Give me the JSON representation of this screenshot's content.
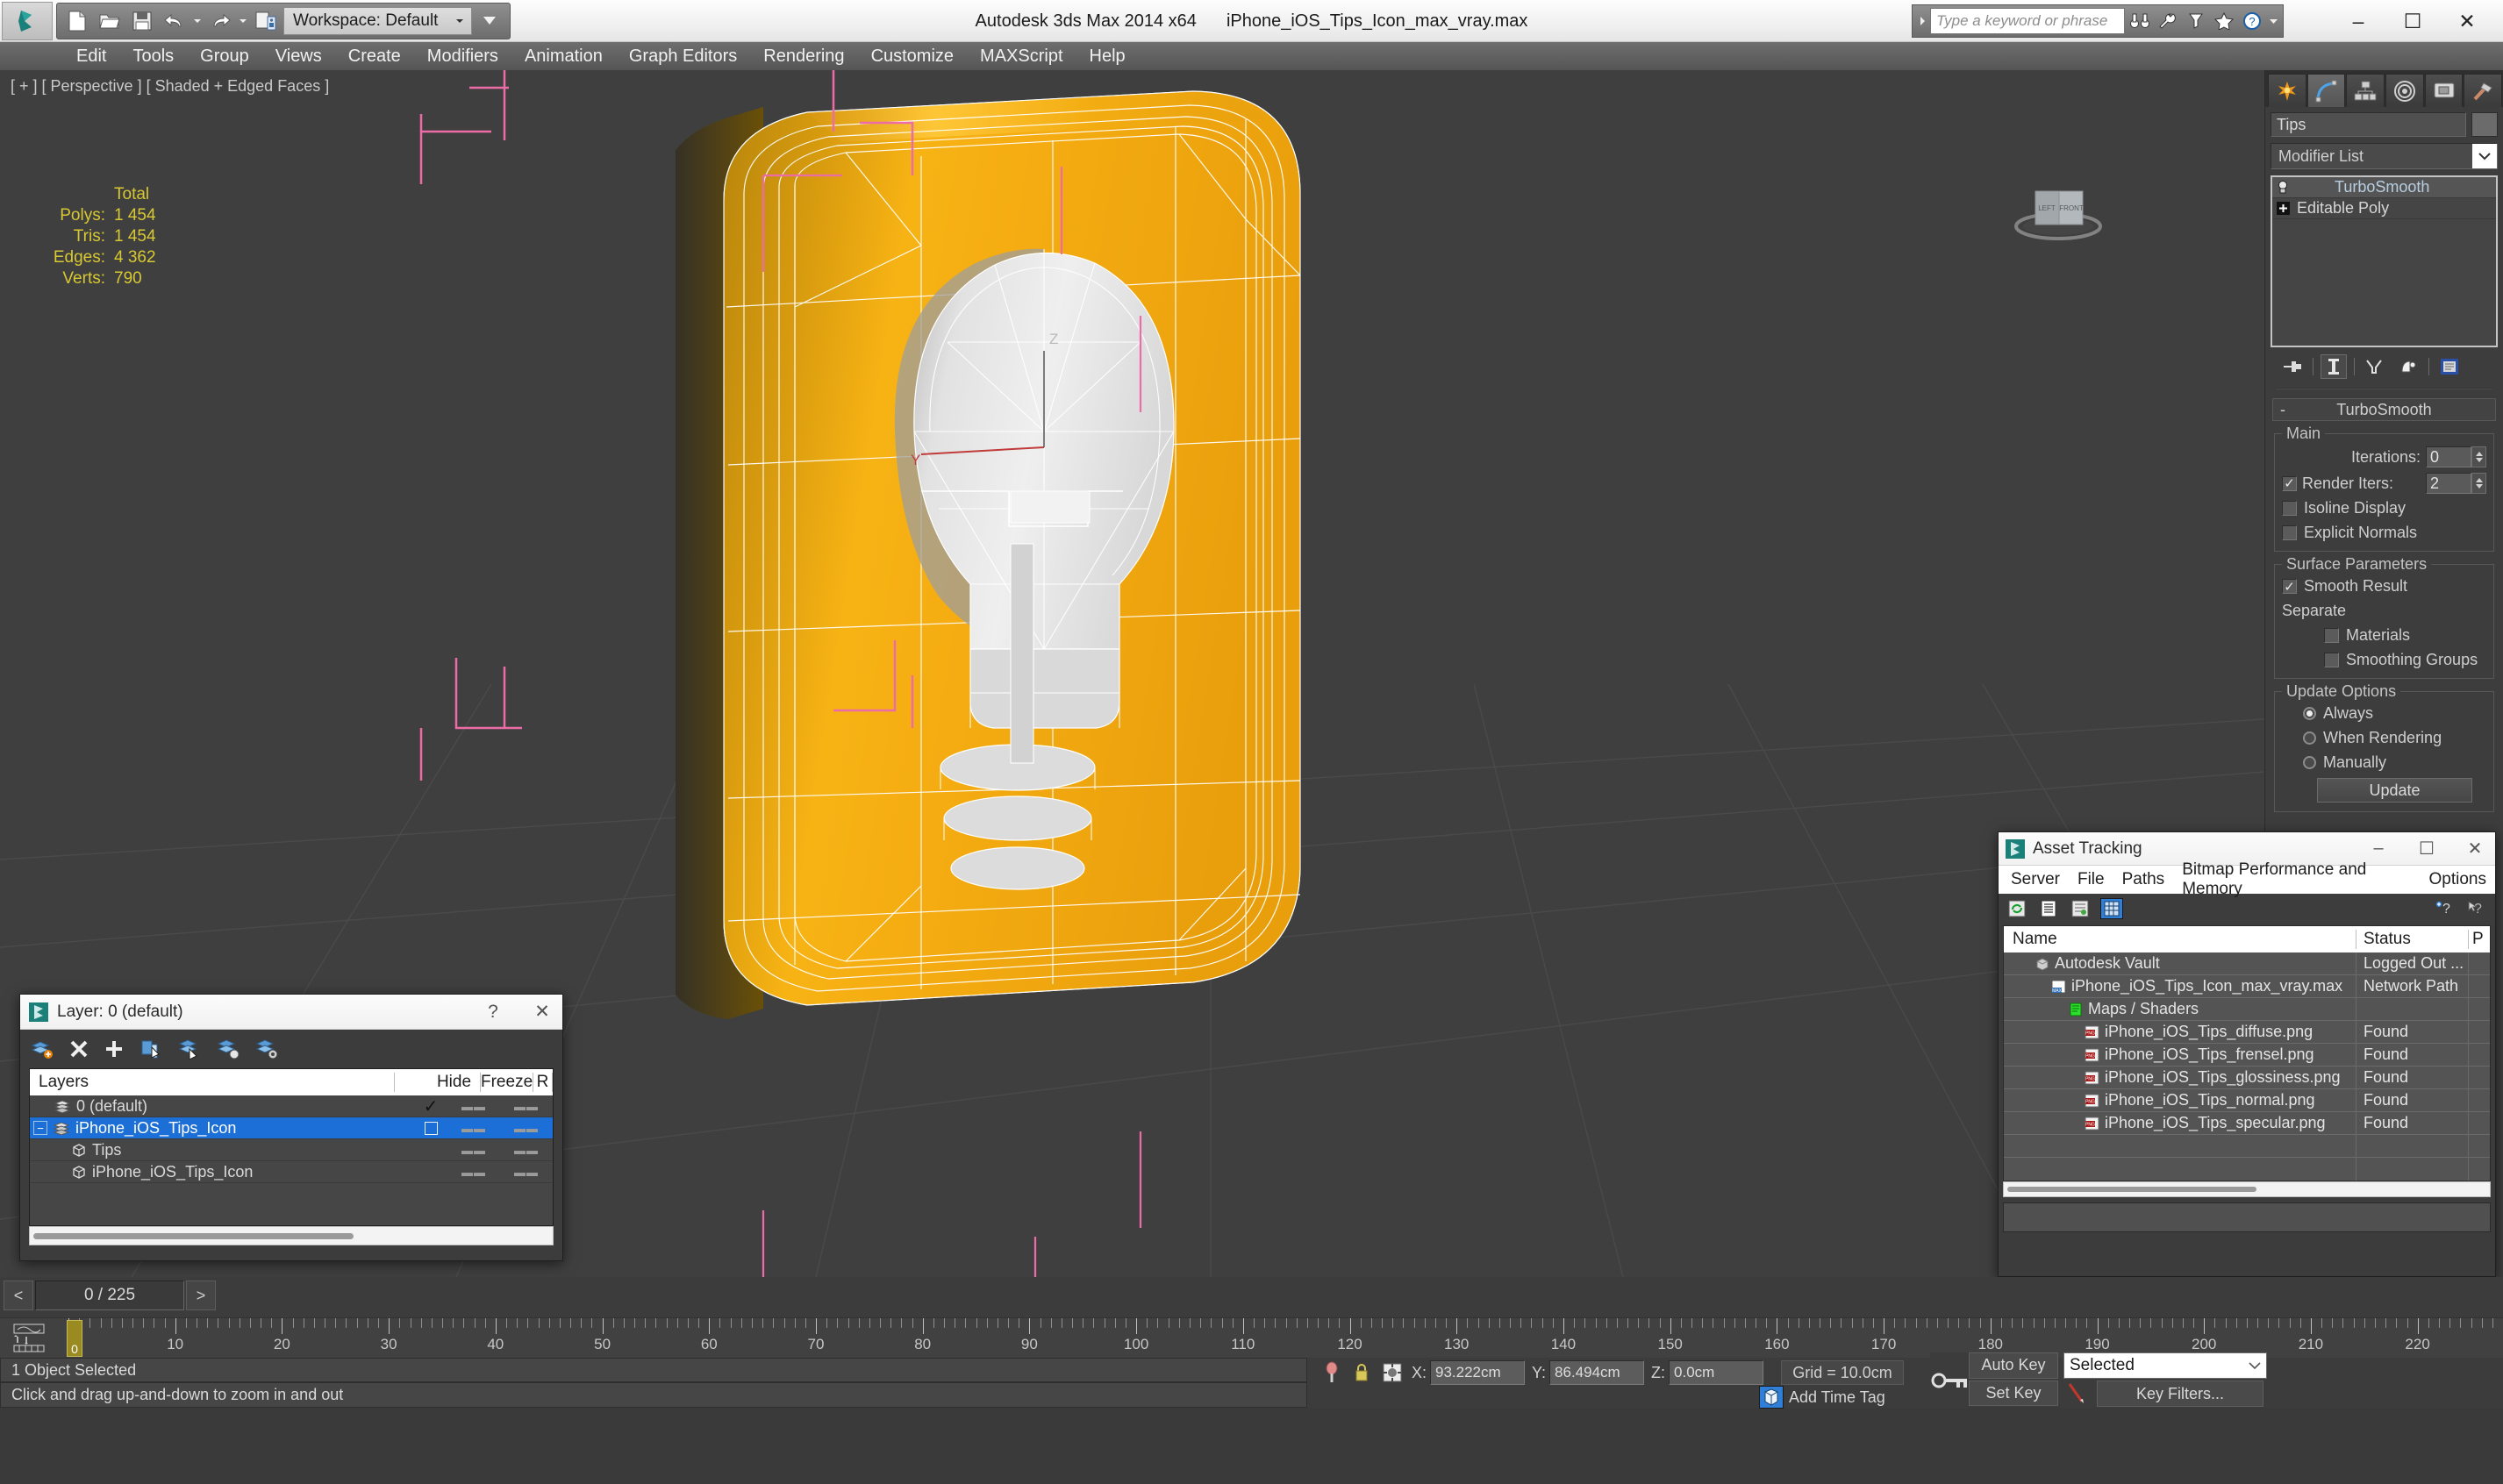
{
  "titlebar": {
    "app_title": "Autodesk 3ds Max  2014 x64",
    "file_name": "iPhone_iOS_Tips_Icon_max_vray.max",
    "workspace_label": "Workspace: Default",
    "search_placeholder": "Type a keyword or phrase",
    "quick_access": [
      {
        "name": "new-file-icon",
        "label": "New"
      },
      {
        "name": "open-file-icon",
        "label": "Open"
      },
      {
        "name": "save-file-icon",
        "label": "Save"
      },
      {
        "name": "undo-icon",
        "label": "Undo"
      },
      {
        "name": "redo-icon",
        "label": "Redo"
      },
      {
        "name": "set-project-folder-icon",
        "label": "Set Project Folder"
      }
    ],
    "search_icons": [
      "binoculars-icon",
      "wrench-icon",
      "funnel-icon",
      "star-icon",
      "help-icon"
    ],
    "window_buttons": {
      "minimize": "–",
      "maximize": "☐",
      "close": "✕"
    }
  },
  "menubar": {
    "items": [
      "Edit",
      "Tools",
      "Group",
      "Views",
      "Create",
      "Modifiers",
      "Animation",
      "Graph Editors",
      "Rendering",
      "Customize",
      "MAXScript",
      "Help"
    ]
  },
  "viewport": {
    "label": "[ + ] [ Perspective ] [ Shaded + Edged Faces ]",
    "stats": {
      "header": "Total",
      "rows": [
        {
          "label": "Polys:",
          "value": "1 454"
        },
        {
          "label": "Tris:",
          "value": "1 454"
        },
        {
          "label": "Edges:",
          "value": "4 362"
        },
        {
          "label": "Verts:",
          "value": "790"
        }
      ]
    },
    "viewcube": {
      "face_left": "LEFT",
      "face_front": "FRONT"
    },
    "axis_tripod": {
      "z": "Z",
      "y": "Y"
    },
    "colors": {
      "background": "#3f3f3f",
      "icon_body": "#f0a81a",
      "icon_body_dark": "#c08b10",
      "bulb": "#e0e0e0",
      "wireframe": "#ffffff",
      "selection_bracket": "#ec6ca8",
      "grid": "#4d4d4d"
    }
  },
  "command_panel": {
    "tabs": [
      {
        "name": "create-tab",
        "icon": "star-burst-icon",
        "active": false
      },
      {
        "name": "modify-tab",
        "icon": "modify-curve-icon",
        "active": true
      },
      {
        "name": "hierarchy-tab",
        "icon": "hierarchy-icon",
        "active": false
      },
      {
        "name": "motion-tab",
        "icon": "motion-wheel-icon",
        "active": false
      },
      {
        "name": "display-tab",
        "icon": "display-monitor-icon",
        "active": false
      },
      {
        "name": "utilities-tab",
        "icon": "hammer-icon",
        "active": false
      }
    ],
    "object_name": "Tips",
    "modifier_list_label": "Modifier List",
    "stack": [
      {
        "label": "TurboSmooth",
        "selected": true,
        "icon": "light-bulb-icon"
      },
      {
        "label": "Editable Poly",
        "selected": false,
        "icon": "plus-box-icon"
      }
    ],
    "stack_buttons": [
      "pin-stack-icon",
      "show-end-result-icon",
      "make-unique-icon",
      "remove-modifier-icon",
      "configure-sets-icon"
    ],
    "rollout": {
      "title": "TurboSmooth",
      "minus": "-",
      "main": {
        "title": "Main",
        "iterations_label": "Iterations:",
        "iterations_value": "0",
        "render_iters_label": "Render Iters:",
        "render_iters_value": "2",
        "render_iters_checked": true,
        "isoline_label": "Isoline Display",
        "isoline_checked": false,
        "explicit_label": "Explicit Normals",
        "explicit_checked": false
      },
      "surface": {
        "title": "Surface Parameters",
        "smooth_result_label": "Smooth Result",
        "smooth_result_checked": true,
        "separate_label": "Separate",
        "materials_label": "Materials",
        "materials_checked": false,
        "smoothing_groups_label": "Smoothing Groups",
        "smoothing_groups_checked": false
      },
      "update": {
        "title": "Update Options",
        "options": [
          {
            "label": "Always",
            "selected": true
          },
          {
            "label": "When Rendering",
            "selected": false
          },
          {
            "label": "Manually",
            "selected": false
          }
        ],
        "button_label": "Update"
      }
    }
  },
  "layer_dialog": {
    "title": "Layer: 0 (default)",
    "help_btn": "?",
    "close_btn": "✕",
    "toolbar_icons": [
      "new-layer-icon",
      "delete-layer-icon",
      "add-layer-icon",
      "select-objects-in-layer-icon",
      "highlight-selected-objects-icon",
      "add-selection-to-layer-icon",
      "set-layer-to-selection-icon"
    ],
    "columns": [
      "Layers",
      "",
      "Hide",
      "Freeze",
      "R"
    ],
    "rows": [
      {
        "name": "0 (default)",
        "indent": 0,
        "icon": "layer-icon",
        "current": "✓",
        "hide": "▬▬",
        "freeze": "▬▬",
        "selected": false,
        "expander": ""
      },
      {
        "name": "iPhone_iOS_Tips_Icon",
        "indent": 0,
        "icon": "layer-icon",
        "current": "□",
        "hide": "▬▬",
        "freeze": "▬▬",
        "selected": true,
        "expander": "-"
      },
      {
        "name": "Tips",
        "indent": 1,
        "icon": "object-box-icon",
        "current": "",
        "hide": "▬▬",
        "freeze": "▬▬",
        "selected": false,
        "expander": ""
      },
      {
        "name": "iPhone_iOS_Tips_Icon",
        "indent": 1,
        "icon": "object-box-icon",
        "current": "",
        "hide": "▬▬",
        "freeze": "▬▬",
        "selected": false,
        "expander": ""
      }
    ]
  },
  "asset_dialog": {
    "title": "Asset Tracking",
    "window_buttons": {
      "minimize": "–",
      "maximize": "☐",
      "close": "✕"
    },
    "menu": [
      "Server",
      "File",
      "Paths",
      "Bitmap Performance and Memory",
      "Options"
    ],
    "toolbar_icons": [
      "refresh-icon",
      "list-view-icon",
      "tree-view-icon",
      "grid-view-icon"
    ],
    "toolbar_right_icons": [
      "add-help-icon",
      "help-cursor-icon"
    ],
    "columns": {
      "name": "Name",
      "status": "Status",
      "path": "P"
    },
    "rows": [
      {
        "name": "Autodesk Vault",
        "status": "Logged Out ...",
        "indent": 1,
        "icon": "vault-icon"
      },
      {
        "name": "iPhone_iOS_Tips_Icon_max_vray.max",
        "status": "Network Path",
        "indent": 2,
        "icon": "max-file-icon"
      },
      {
        "name": "Maps / Shaders",
        "status": "",
        "indent": 3,
        "icon": "maps-shaders-icon"
      },
      {
        "name": "iPhone_iOS_Tips_diffuse.png",
        "status": "Found",
        "indent": 4,
        "icon": "png-file-icon"
      },
      {
        "name": "iPhone_iOS_Tips_frensel.png",
        "status": "Found",
        "indent": 4,
        "icon": "png-file-icon"
      },
      {
        "name": "iPhone_iOS_Tips_glossiness.png",
        "status": "Found",
        "indent": 4,
        "icon": "png-file-icon"
      },
      {
        "name": "iPhone_iOS_Tips_normal.png",
        "status": "Found",
        "indent": 4,
        "icon": "png-file-icon"
      },
      {
        "name": "iPhone_iOS_Tips_specular.png",
        "status": "Found",
        "indent": 4,
        "icon": "png-file-icon"
      },
      {
        "name": "",
        "status": "",
        "indent": 0,
        "icon": ""
      },
      {
        "name": "",
        "status": "",
        "indent": 0,
        "icon": ""
      }
    ]
  },
  "bottom": {
    "frame_field": "0 / 225",
    "prev_arrow": "<",
    "next_arrow": ">",
    "timeslider_label": "0",
    "ruler_labels": [
      10,
      20,
      30,
      40,
      50,
      60,
      70,
      80,
      90,
      100,
      110,
      120,
      130,
      140,
      150,
      160,
      170,
      180,
      190,
      200,
      210,
      220
    ],
    "status_text": "1 Object Selected",
    "prompt_text": "Click and drag up-and-down to zoom in and out",
    "coords": [
      {
        "label": "X:",
        "value": "93.222cm"
      },
      {
        "label": "Y:",
        "value": "86.494cm"
      },
      {
        "label": "Z:",
        "value": "0.0cm"
      }
    ],
    "grid_text": "Grid = 10.0cm",
    "add_time_tag": "Add Time Tag",
    "auto_key": "Auto Key",
    "set_key": "Set Key",
    "key_filters": "Key Filters...",
    "selection_combo": "Selected",
    "current_frame": "0",
    "playback_icons": [
      "go-to-start-icon",
      "previous-frame-icon",
      "play-animation-icon",
      "next-frame-icon",
      "go-to-end-icon"
    ],
    "nav_icons_row1": [
      "zoom-icon",
      "zoom-all-icon",
      "zoom-extents-icon",
      "zoom-extents-all-icon"
    ],
    "nav_icons_row2": [
      "time-config-icon",
      "pan-icon",
      "walkthrough-icon",
      "orbit-icon",
      "maximize-viewport-icon"
    ],
    "lock_icons": [
      "pin-selection-icon",
      "lock-selection-icon",
      "transform-center-icon"
    ]
  }
}
